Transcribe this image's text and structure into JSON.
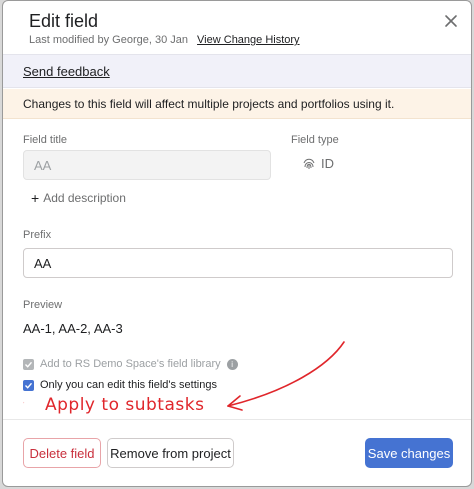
{
  "dialog": {
    "title": "Edit field",
    "last_modified": "Last modified by George, 30 Jan",
    "history_link": "View Change History",
    "close_icon": "close-icon"
  },
  "feedback": {
    "link_text": "Send feedback"
  },
  "warning": {
    "text": "Changes to this field will affect multiple projects and portfolios using it."
  },
  "form": {
    "field_title_label": "Field title",
    "field_title_placeholder": "AA",
    "field_type_label": "Field type",
    "field_type_value": "ID",
    "field_type_icon": "fingerprint-icon",
    "add_description": "Add description",
    "prefix_label": "Prefix",
    "prefix_value": "AA",
    "preview_label": "Preview",
    "preview_value": "AA-1, AA-2, AA-3",
    "library_checkbox": {
      "label": "Add to RS Demo Space's field library",
      "checked": true,
      "disabled": true
    },
    "permission_checkbox": {
      "label": "Only you can edit this field's settings",
      "checked": true,
      "disabled": false
    }
  },
  "annotation": {
    "text": "Apply to subtasks",
    "color": "#e0262b"
  },
  "footer": {
    "delete_label": "Delete field",
    "remove_label": "Remove from project",
    "save_label": "Save changes"
  },
  "colors": {
    "accent": "#4573d2",
    "danger": "#c92f3c",
    "warning_bg": "#fdf3e7",
    "feedback_bg": "#f1f1f9"
  }
}
